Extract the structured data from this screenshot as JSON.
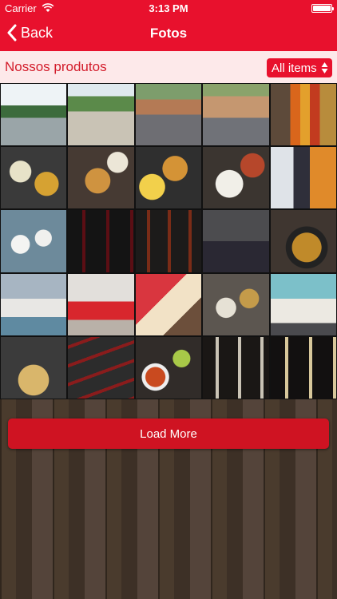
{
  "status": {
    "carrier": "Carrier",
    "time": "3:13 PM"
  },
  "nav": {
    "back_label": "Back",
    "title": "Fotos"
  },
  "section": {
    "title": "Nossos produtos",
    "filter_label": "All items"
  },
  "photos": [
    {
      "art": "t-sky"
    },
    {
      "art": "t-sky2"
    },
    {
      "art": "t-bldg"
    },
    {
      "art": "t-bldg2"
    },
    {
      "art": "t-sauce"
    },
    {
      "art": "t-food"
    },
    {
      "art": "t-food2"
    },
    {
      "art": "t-food3"
    },
    {
      "art": "t-food4"
    },
    {
      "art": "t-man"
    },
    {
      "art": "t-cups"
    },
    {
      "art": "t-bottles"
    },
    {
      "art": "t-bottles2"
    },
    {
      "art": "t-shelf"
    },
    {
      "art": "t-pan"
    },
    {
      "art": "t-table"
    },
    {
      "art": "t-store"
    },
    {
      "art": "t-pizza"
    },
    {
      "art": "t-plates"
    },
    {
      "art": "t-drinks"
    },
    {
      "art": "t-hands"
    },
    {
      "art": "t-winerack"
    },
    {
      "art": "t-soup"
    },
    {
      "art": "t-wine2"
    },
    {
      "art": "t-wine3"
    }
  ],
  "load_more_label": "Load More",
  "colors": {
    "header": "#e8112d",
    "section_bg": "#fde9ea",
    "section_text": "#d31c2b",
    "button": "#cf1322"
  }
}
